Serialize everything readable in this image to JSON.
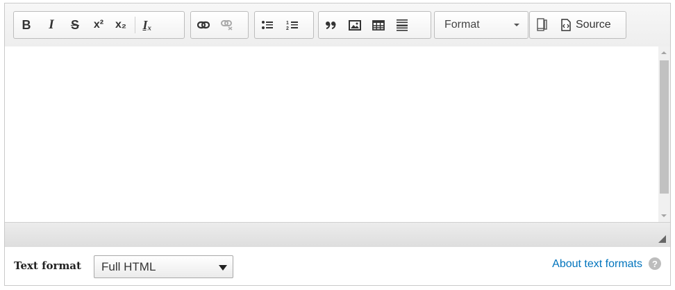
{
  "toolbar": {
    "basic": [
      "B",
      "I",
      "S",
      "x²",
      "x₂",
      "Iₓ"
    ],
    "format_combo": {
      "label": "Format"
    },
    "source_label": "Source"
  },
  "editor": {
    "content": ""
  },
  "text_format": {
    "label": "Text format",
    "selected": "Full HTML",
    "about_link": "About text formats",
    "help_glyph": "?"
  },
  "colors": {
    "link": "#0074bd",
    "border": "#c9c9c9",
    "toolbar_bg": "#eeeeee"
  }
}
